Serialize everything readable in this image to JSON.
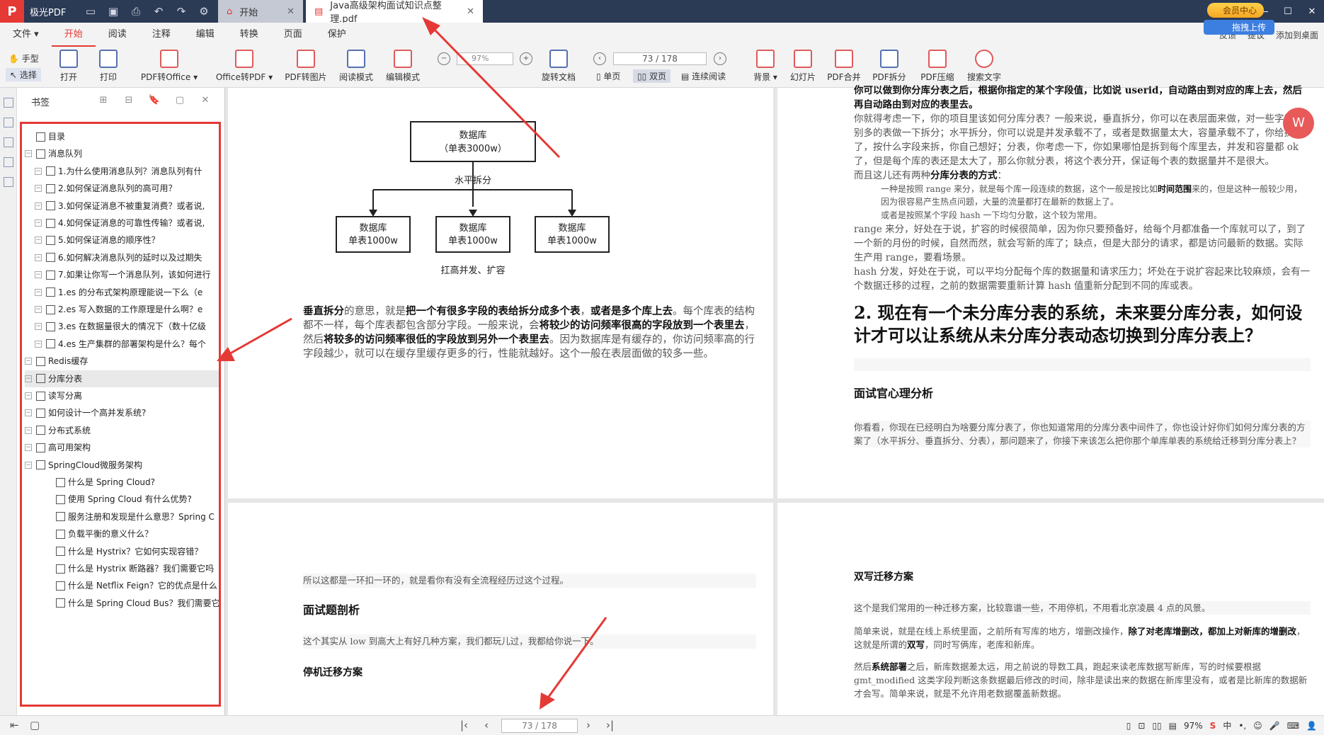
{
  "app": {
    "name": "极光PDF"
  },
  "tabs": [
    {
      "label": "开始"
    },
    {
      "label": "Java高级架构面试知识点整理.pdf"
    }
  ],
  "vip_label": "会员中心",
  "upload_label": "拖拽上传",
  "menu": [
    "文件",
    "开始",
    "阅读",
    "注释",
    "编辑",
    "转换",
    "页面",
    "保护"
  ],
  "menu_right": [
    "反馈",
    "提议",
    "添加到桌面"
  ],
  "toolbar": {
    "hand": "手型",
    "select": "选择",
    "tools": [
      "打开",
      "打印",
      "PDF转Office",
      "Office转PDF",
      "PDF转图片",
      "阅读模式",
      "编辑模式",
      "旋转文档",
      "背景",
      "幻灯片",
      "PDF合并",
      "PDF拆分",
      "PDF压缩",
      "搜索文字"
    ],
    "zoom": "97%",
    "page": "73 / 178",
    "views": [
      "单页",
      "双页",
      "连续阅读"
    ]
  },
  "sidebar": {
    "title": "书签",
    "items": [
      {
        "label": "目录",
        "level": 0,
        "exp": false
      },
      {
        "label": "消息队列",
        "level": 0,
        "exp": true
      },
      {
        "label": "1.为什么使用消息队列？消息队列有什",
        "level": 1,
        "exp": true
      },
      {
        "label": "2.如何保证消息队列的高可用？",
        "level": 1,
        "exp": true
      },
      {
        "label": "3.如何保证消息不被重复消费？或者说,",
        "level": 1,
        "exp": true
      },
      {
        "label": "4.如何保证消息的可靠性传输？或者说,",
        "level": 1,
        "exp": true
      },
      {
        "label": "5.如何保证消息的顺序性？",
        "level": 1,
        "exp": true
      },
      {
        "label": "6.如何解决消息队列的延时以及过期失",
        "level": 1,
        "exp": true
      },
      {
        "label": "7.如果让你写一个消息队列，该如何进行",
        "level": 1,
        "exp": true
      },
      {
        "label": "1.es 的分布式架构原理能说一下么（e",
        "level": 1,
        "exp": true
      },
      {
        "label": "2.es 写入数据的工作原理是什么啊？e",
        "level": 1,
        "exp": true
      },
      {
        "label": "3.es 在数据量很大的情况下（数十亿级",
        "level": 1,
        "exp": true
      },
      {
        "label": "4.es 生产集群的部署架构是什么？每个",
        "level": 1,
        "exp": true
      },
      {
        "label": "Redis缓存",
        "level": 0,
        "exp": true
      },
      {
        "label": "分库分表",
        "level": 0,
        "exp": true,
        "hl": true
      },
      {
        "label": "读写分离",
        "level": 0,
        "exp": true
      },
      {
        "label": "如何设计一个高并发系统?",
        "level": 0,
        "exp": true
      },
      {
        "label": "分布式系统",
        "level": 0,
        "exp": true
      },
      {
        "label": "高可用架构",
        "level": 0,
        "exp": true
      },
      {
        "label": "SpringCloud微服务架构",
        "level": 0,
        "exp": true
      },
      {
        "label": "什么是 Spring Cloud?",
        "level": 2,
        "exp": false
      },
      {
        "label": "使用 Spring Cloud 有什么优势?",
        "level": 2,
        "exp": false
      },
      {
        "label": "服务注册和发现是什么意思？Spring C",
        "level": 2,
        "exp": false
      },
      {
        "label": "负载平衡的意义什么？",
        "level": 2,
        "exp": false
      },
      {
        "label": "什么是 Hystrix？它如何实现容错？",
        "level": 2,
        "exp": false
      },
      {
        "label": "什么是 Hystrix 断路器？我们需要它吗",
        "level": 2,
        "exp": false
      },
      {
        "label": "什么是 Netflix Feign？它的优点是什么",
        "level": 2,
        "exp": false
      },
      {
        "label": "什么是 Spring Cloud Bus？我们需要它",
        "level": 2,
        "exp": false
      }
    ]
  },
  "diagram": {
    "top": "数据库\n（单表3000w）",
    "split": "水平拆分",
    "children": [
      "数据库\n单表1000w",
      "数据库\n单表1000w",
      "数据库\n单表1000w"
    ],
    "caption": "扛高并发、扩容"
  },
  "page1": {
    "para": [
      {
        "t": "垂直拆分",
        "b": true
      },
      {
        "t": "的意思，就是"
      },
      {
        "t": "把一个有很多字段的表给拆分成多个表",
        "b": true
      },
      {
        "t": "，"
      },
      {
        "t": "或者是多个库上去",
        "b": true
      },
      {
        "t": "。每个库表的结构都不一样，每个库表都包含部分字段。一般来说，会"
      },
      {
        "t": "将较少的访问频率很高的字段放到一个表里去",
        "b": true
      },
      {
        "t": "，然后"
      },
      {
        "t": "将较多的访问频率很低的字段放到另外一个表里去",
        "b": true
      },
      {
        "t": "。因为数据库是有缓存的，你访问频率高的行字段越少，就可以在缓存里缓存更多的行，性能就越好。这个一般在表层面做的较多一些。"
      }
    ]
  },
  "page2": {
    "top_line": "你可以做到你分库分表之后，根据你指定的某个字段值，比如说 userid，自动路由到对应的库上去，然后再自动路由到对应的表里去。",
    "p1": "你就得考虑一下，你的项目里该如何分库分表？一般来说，垂直拆分，你可以在表层面来做，对一些字段特别多的表做一下拆分；水平拆分，你可以说是并发承载不了，或者是数据量太大，容量承载不了，你给拆了，按什么字段来拆，你自己想好；分表，你考虑一下，你如果哪怕是拆到每个库里去，并发和容量都 ok 了，但是每个库的表还是太大了，那么你就分表，将这个表分开，保证每个表的数据量并不是很大。",
    "p2a": "而且这儿还有两种",
    "p2b": "分库分表的方式",
    "p2c": "：",
    "li1a": "一种是按照 range 来分，就是每个库一段连续的数据，这个一般是按比如",
    "li1b": "时间范围",
    "li1c": "来的，但是这种一般较少用，因为很容易产生热点问题，大量的流量都打在最新的数据上了。",
    "li2": "或者是按照某个字段 hash 一下均匀分散，这个较为常用。",
    "p3": "range 来分，好处在于说，扩容的时候很简单，因为你只要预备好，给每个月都准备一个库就可以了，到了一个新的月份的时候，自然而然，就会写新的库了；缺点，但是大部分的请求，都是访问最新的数据。实际生产用 range，要看场景。",
    "p4": "hash 分发，好处在于说，可以平均分配每个库的数据量和请求压力；坏处在于说扩容起来比较麻烦，会有一个数据迁移的过程，之前的数据需要重新计算 hash 值重新分配到不同的库或表。",
    "h2": "2. 现在有一个未分库分表的系统，未来要分库分表，如何设计才可以让系统从未分库分表动态切换到分库分表上？",
    "h3": "面试官心理分析",
    "p5": "你看看，你现在已经明白为啥要分库分表了，你也知道常用的分库分表中间件了，你也设计好你们如何分库分表的方案了（水平拆分、垂直拆分、分表），那问题来了，你接下来该怎么把你那个单库单表的系统给迁移到分库分表上？"
  },
  "page3": {
    "p1": "所以这都是一环扣一环的，就是看你有没有全流程经历过这个过程。",
    "h3a": "面试题剖析",
    "p2": "这个其实从 low 到高大上有好几种方案，我们都玩儿过，我都给你说一下。",
    "h3b": "停机迁移方案"
  },
  "page4": {
    "h3": "双写迁移方案",
    "p1": "这个是我们常用的一种迁移方案，比较靠谱一些，不用停机，不用看北京凌晨 4 点的风景。",
    "p2a": "简单来说，就是在线上系统里面，之前所有写库的地方，增删改操作，",
    "p2b": "除了对老库增删改，都加上对新库的增删改",
    "p2c": "，这就是所谓的",
    "p2d": "双写",
    "p2e": "，同时写俩库，老库和新库。",
    "p3a": "然后",
    "p3b": "系统部署",
    "p3c": "之后，新库数据差太远，用之前说的导数工具，跑起来读老库数据写新库，写的时候要根据 gmt_modified 这类字段判断这条数据最后修改的时间，除非是读出来的数据在新库里没有，或者是比新库的数据新才会写。简单来说，就是不允许用老数据覆盖新数据。"
  },
  "status": {
    "page": "73 / 178",
    "zoom": "97%"
  },
  "colors": {
    "accent": "#e53935",
    "titlebar": "#2b3a55"
  }
}
